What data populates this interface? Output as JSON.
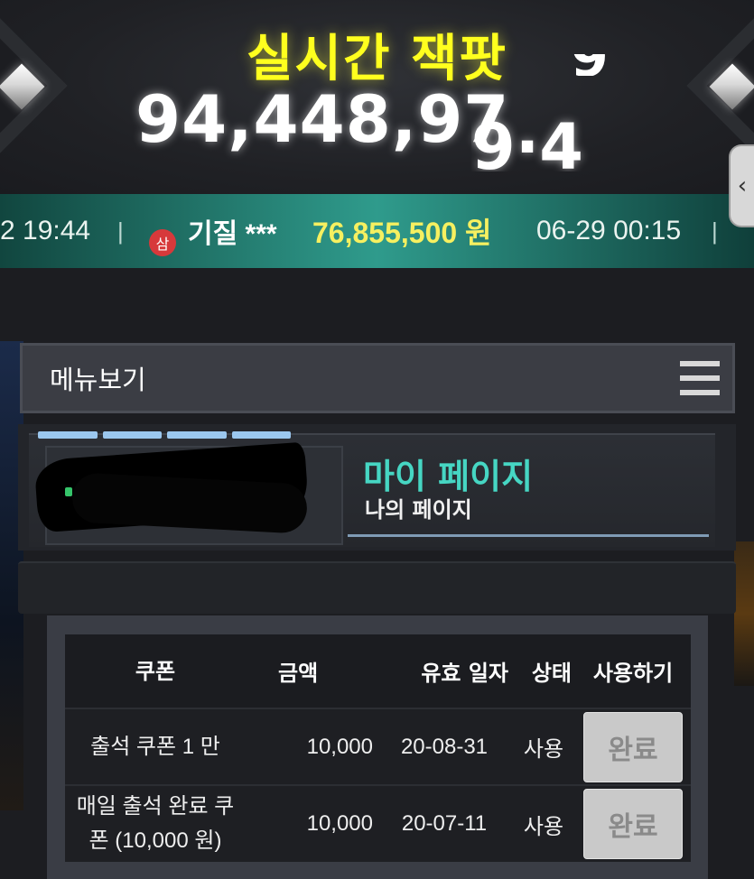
{
  "jackpot": {
    "title": "실시간 잭팟",
    "amount": "94,448,97",
    "rolling_digits": "9·4",
    "rolling_partial": "_9"
  },
  "ticker": {
    "prev_time": "2 19:44",
    "separator": "|",
    "badge": "삼",
    "name": "기질 ***",
    "amount": "76,855,500 원",
    "time": "06-29 00:15"
  },
  "side_tab": {
    "icon": "chevron-left-icon",
    "glyph": "‹"
  },
  "menu": {
    "label": "메뉴보기",
    "icon": "hamburger-menu-icon"
  },
  "banner": {
    "title": "마이 페이지",
    "subtitle": "나의 페이지"
  },
  "coupon_table": {
    "headers": [
      "쿠폰",
      "금액",
      "유효 일자",
      "상태",
      "사용하기"
    ],
    "rows": [
      {
        "name": "출석 쿠폰 1 만",
        "amount": "10,000",
        "date": "20-08-31",
        "status": "사용",
        "action": "완료"
      },
      {
        "name": "매일 출석 완료 쿠폰 (10,000 원)",
        "amount": "10,000",
        "date": "20-07-11",
        "status": "사용",
        "action": "완료"
      }
    ]
  },
  "colors": {
    "jackpot_title": "#ffff1e",
    "ticker_amount": "#f6f060",
    "banner_title": "#46d6c3",
    "badge": "#d7393b"
  }
}
